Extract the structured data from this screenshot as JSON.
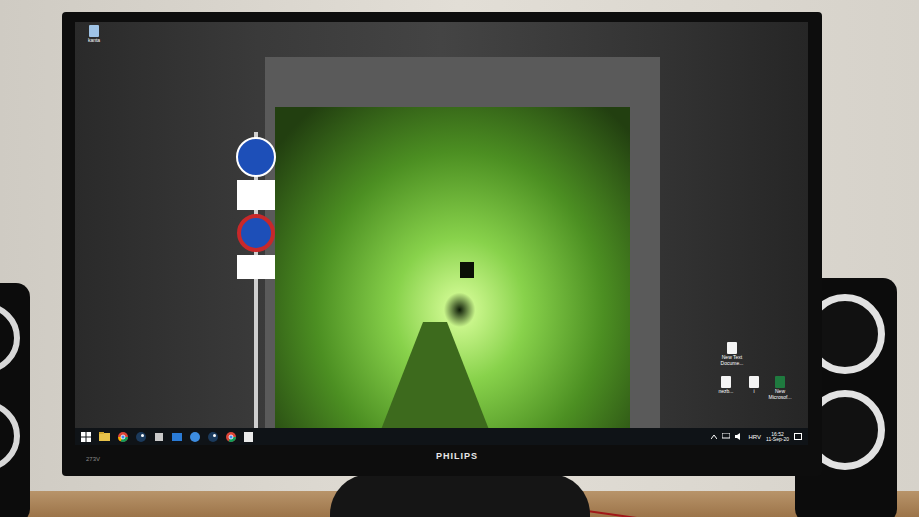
{
  "desktop": {
    "icons": [
      {
        "label": "kanta"
      },
      {
        "label": "New Text Docume..."
      },
      {
        "label": "nezb..."
      },
      {
        "label": "i"
      },
      {
        "label": "New Microsof..."
      }
    ]
  },
  "taskbar": {
    "language": "HRV",
    "time": "16:52",
    "date": "11-Sep-20"
  },
  "monitor": {
    "brand": "PHILIPS",
    "model": "273V"
  }
}
